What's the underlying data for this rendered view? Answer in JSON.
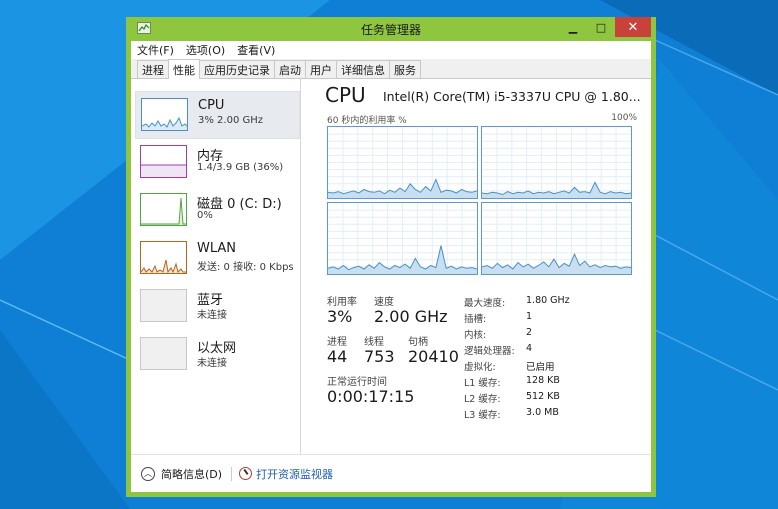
{
  "window": {
    "title": "任务管理器",
    "controls": {
      "minimize": "▁",
      "maximize": "□",
      "close": "✕"
    }
  },
  "menu": [
    "文件(F)",
    "选项(O)",
    "查看(V)"
  ],
  "tabs": [
    "进程",
    "性能",
    "应用历史记录",
    "启动",
    "用户",
    "详细信息",
    "服务"
  ],
  "active_tab": "性能",
  "sidebar": [
    {
      "name": "CPU",
      "sub": "3%  2.00 GHz",
      "color": "#4a90c8",
      "fill": "#dbeaf5",
      "selected": true,
      "utilization": 0.03
    },
    {
      "name": "内存",
      "sub": "1.4/3.9 GB (36%)",
      "color": "#9b3fae",
      "fill": "#f1e4f4",
      "selected": false,
      "utilization": 0.36
    },
    {
      "name": "磁盘 0 (C: D:)",
      "sub": "0%",
      "color": "#4ea83c",
      "fill": "#e3f1dd",
      "selected": false,
      "utilization": 0.0
    },
    {
      "name": "WLAN",
      "sub": "发送: 0  接收: 0 Kbps",
      "color": "#b5651d",
      "fill": "#f6e6d6",
      "selected": false
    },
    {
      "name": "蓝牙",
      "sub": "未连接",
      "color": "#bdbdbd",
      "fill": "#f0f0f0",
      "selected": false
    },
    {
      "name": "以太网",
      "sub": "未连接",
      "color": "#bdbdbd",
      "fill": "#f0f0f0",
      "selected": false
    }
  ],
  "main": {
    "title": "CPU",
    "model": "Intel(R) Core(TM) i5-3337U CPU @ 1.80...",
    "graph_caption": "60 秒内的利用率 %",
    "graph_max": "100%",
    "graph_color": "#4a90c8",
    "graph_fill": "#c7dff0",
    "stats": {
      "utilization_label": "利用率",
      "utilization": "3%",
      "speed_label": "速度",
      "speed": "2.00 GHz",
      "processes_label": "进程",
      "processes": "44",
      "threads_label": "线程",
      "threads": "753",
      "handles_label": "句柄",
      "handles": "20410",
      "uptime_label": "正常运行时间",
      "uptime": "0:00:17:15"
    },
    "specs": [
      {
        "key": "最大速度:",
        "value": "1.80 GHz"
      },
      {
        "key": "插槽:",
        "value": "1"
      },
      {
        "key": "内核:",
        "value": "2"
      },
      {
        "key": "逻辑处理器:",
        "value": "4"
      },
      {
        "key": "虚拟化:",
        "value": "已启用"
      },
      {
        "key": "L1 缓存:",
        "value": "128 KB"
      },
      {
        "key": "L2 缓存:",
        "value": "512 KB"
      },
      {
        "key": "L3 缓存:",
        "value": "3.0 MB"
      }
    ]
  },
  "footer": {
    "fewer_details": "简略信息(D)",
    "open_monitor": "打开资源监视器"
  }
}
